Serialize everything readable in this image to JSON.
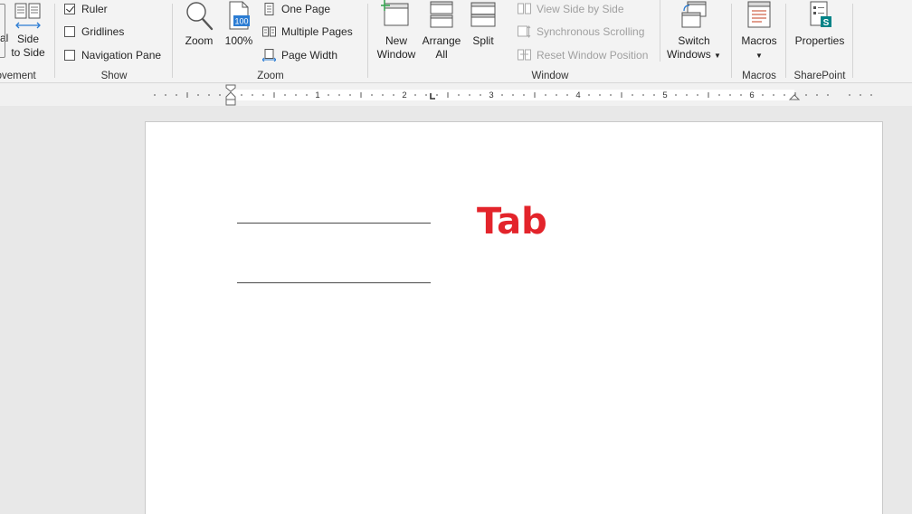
{
  "ribbon": {
    "movement": {
      "label": "Movement",
      "partial_left_label": "al",
      "side_to_side": {
        "line1": "Side",
        "line2": "to Side"
      }
    },
    "show": {
      "label": "Show",
      "ruler": {
        "label": "Ruler",
        "checked": true
      },
      "gridlines": {
        "label": "Gridlines",
        "checked": false
      },
      "navigation_pane": {
        "label": "Navigation Pane",
        "checked": false
      }
    },
    "zoom": {
      "label": "Zoom",
      "zoom_button": "Zoom",
      "zoom100_button": "100%",
      "zoom100_icon_text": "100",
      "one_page": "One Page",
      "multiple_pages": "Multiple Pages",
      "page_width": "Page Width"
    },
    "window": {
      "label": "Window",
      "new_window": {
        "line1": "New",
        "line2": "Window"
      },
      "arrange_all": {
        "line1": "Arrange",
        "line2": "All"
      },
      "split": "Split",
      "view_side_by_side": "View Side by Side",
      "synchronous_scrolling": "Synchronous Scrolling",
      "reset_window_position": "Reset Window Position",
      "switch_windows": {
        "line1": "Switch",
        "line2": "Windows"
      }
    },
    "macros": {
      "label": "Macros",
      "button": "Macros"
    },
    "sharepoint": {
      "label": "SharePoint",
      "properties": "Properties",
      "badge": "S"
    }
  },
  "ruler": {
    "numbers": [
      "1",
      "2",
      "3",
      "4",
      "5",
      "6"
    ]
  },
  "document": {
    "tab_text": "Tab"
  },
  "colors": {
    "accent_blue": "#2b7cd3",
    "tab_text_red": "#e3242b",
    "sharepoint_teal": "#038387",
    "new_window_green": "#3aa655"
  }
}
